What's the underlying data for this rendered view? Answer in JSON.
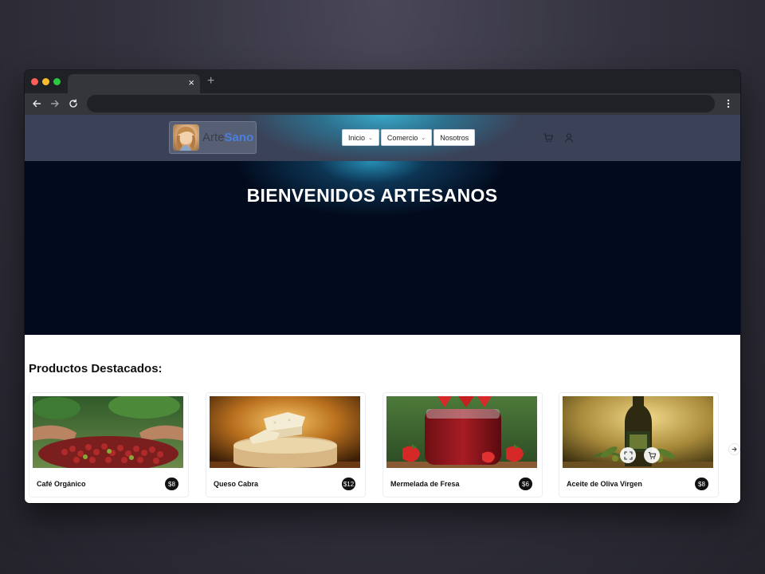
{
  "browser": {
    "tab_title": "",
    "close_tab_glyph": "×",
    "new_tab_glyph": "+",
    "url": ""
  },
  "site": {
    "logo": {
      "text_plain": "Arte",
      "text_bold": "Sano",
      "accent_color": "#4a7fe0"
    },
    "nav": [
      {
        "label": "Inicio",
        "has_dropdown": true
      },
      {
        "label": "Comercio",
        "has_dropdown": true
      },
      {
        "label": "Nosotros",
        "has_dropdown": false
      }
    ],
    "header_icons": [
      "cart-icon",
      "user-icon"
    ]
  },
  "hero": {
    "title": "BIENVENIDOS ARTESANOS"
  },
  "featured": {
    "title": "Productos Destacados:",
    "products": [
      {
        "name": "Café Orgánico",
        "price": "$8",
        "image": "coffee-cherries-image"
      },
      {
        "name": "Queso Cabra",
        "price": "$12",
        "image": "goat-cheese-image"
      },
      {
        "name": "Mermelada de Fresa",
        "price": "$6",
        "image": "strawberry-jam-image"
      },
      {
        "name": "Aceite de Oliva Virgen",
        "price": "$8",
        "image": "olive-oil-image",
        "hover_actions": [
          "expand-icon",
          "cart-icon"
        ]
      }
    ],
    "next_glyph": "›"
  }
}
